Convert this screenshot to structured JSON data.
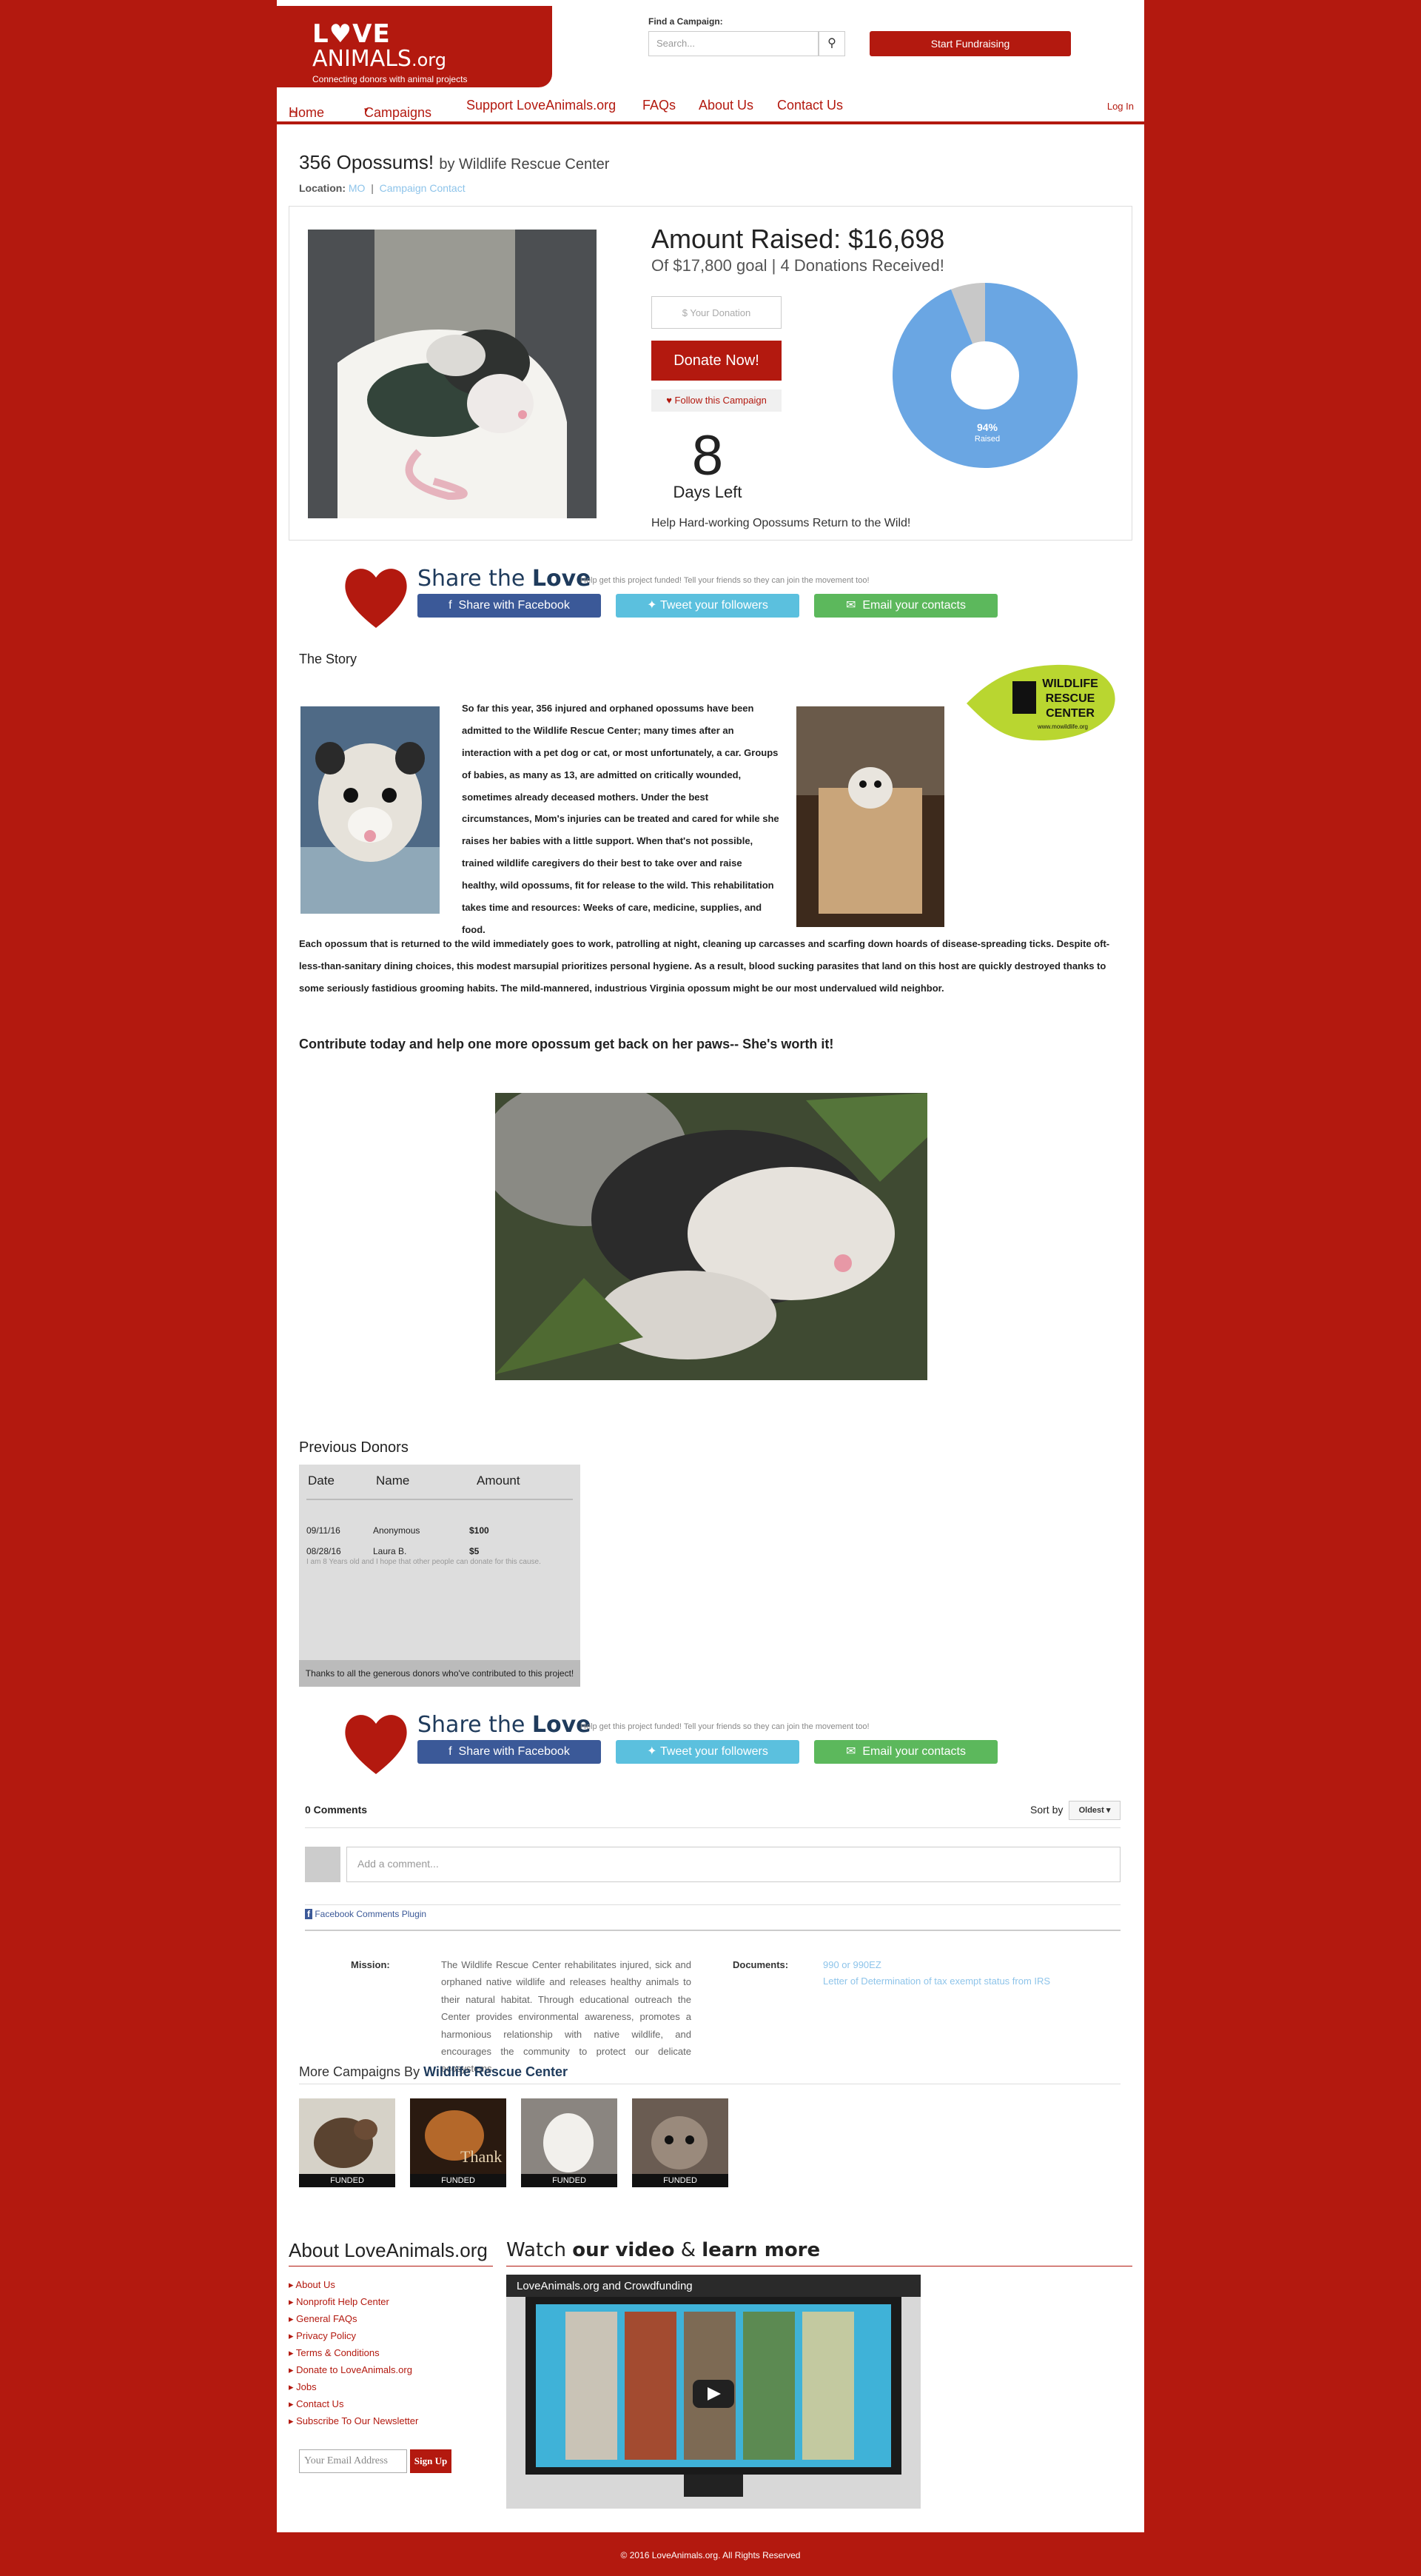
{
  "header": {
    "logo_line1": "L♥VE",
    "logo_line2": "ANIMALS",
    "logo_suffix": ".org",
    "tagline": "Connecting donors with animal projects",
    "find_label": "Find a Campaign:",
    "search_placeholder": "Search...",
    "start_label": "Start Fundraising"
  },
  "nav": {
    "home": "Home",
    "campaigns": "Campaigns",
    "support": "Support LoveAnimals.org",
    "faqs": "FAQs",
    "about": "About Us",
    "contact": "Contact Us",
    "login": "Log In"
  },
  "campaign": {
    "title": "356 Opossums!",
    "by": "by Wildlife Rescue Center",
    "location_label": "Location:",
    "location": "MO",
    "contact_link": "Campaign Contact",
    "amount_raised": "Amount Raised: $16,698",
    "goal_line": "Of $17,800 goal | 4 Donations Received!",
    "donation_placeholder": "$ Your Donation",
    "donate_label": "Donate Now!",
    "follow_label": "Follow this Campaign",
    "days": "8",
    "days_label": "Days Left",
    "subtitle": "Help Hard-working Opossums Return to the Wild!",
    "raised_fraction": 0.94,
    "pie_label_pct": "94%",
    "pie_label_text": "Raised"
  },
  "share": {
    "title_a": "Share the ",
    "title_b": "Love",
    "sub": "Help get this project funded! Tell your friends so they can join the movement too!",
    "facebook": "Share with Facebook",
    "twitter": "Tweet your followers",
    "email": "Email your contacts"
  },
  "story": {
    "heading": "The Story",
    "p1": "So far this year, 356 injured and orphaned opossums have been admitted to the Wildlife Rescue Center; many times after an interaction with a pet dog or cat, or most unfortunately, a car. Groups of babies, as many as 13, are admitted on critically wounded, sometimes already deceased mothers. Under the best circumstances, Mom's injuries can be treated and cared for while she raises her babies with a little support. When that's not possible, trained wildlife caregivers do their best to take over and raise healthy, wild opossums, fit for release to the wild. This rehabilitation takes time and resources: Weeks of care, medicine, supplies, and food.",
    "p2": "Each opossum that is returned to the wild immediately goes to work, patrolling at night, cleaning up carcasses and scarfing down hoards of disease-spreading ticks.  Despite oft-less-than-sanitary dining choices, this modest marsupial prioritizes personal hygiene. As a result, blood sucking parasites that land on this host are quickly destroyed thanks to some seriously fastidious grooming habits. The mild-mannered, industrious Virginia opossum might be our most undervalued wild neighbor.",
    "cta": "Contribute today and help one more opossum get back on her paws-- She's worth it!",
    "badge_line1": "WILDLIFE",
    "badge_line2": "RESCUE",
    "badge_line3": "CENTER",
    "badge_url": "www.mowildlife.org"
  },
  "donors": {
    "heading": "Previous Donors",
    "col_date": "Date",
    "col_name": "Name",
    "col_amount": "Amount",
    "rows": [
      {
        "date": "09/11/16",
        "name": "Anonymous",
        "amount": "$100",
        "note": ""
      },
      {
        "date": "08/28/16",
        "name": "Laura B.",
        "amount": "$5",
        "note": "I am 8 Years old and I hope that other people can donate for this cause."
      }
    ],
    "footer": "Thanks to all the generous donors who've contributed to this project!"
  },
  "comments": {
    "count": "0 Comments",
    "sort_label": "Sort by",
    "sort_value": "Oldest ▾",
    "placeholder": "Add a comment...",
    "plugin": "Facebook Comments Plugin"
  },
  "org": {
    "mission_label": "Mission:",
    "mission": "The Wildlife Rescue Center rehabilitates injured, sick and orphaned native wildlife and releases healthy animals to their natural habitat. Through educational outreach the Center provides environmental awareness, promotes a harmonious relationship with native wildlife, and encourages the community to protect our delicate ecosystems.",
    "documents_label": "Documents:",
    "doc1": "990 or 990EZ",
    "doc2": "Letter of Determination of tax exempt status from IRS"
  },
  "more": {
    "heading_a": "More Campaigns By ",
    "heading_b": "Wildlife Rescue Center",
    "funded": "FUNDED",
    "thumb2_text": "Thank"
  },
  "footer": {
    "about_title": "About LoveAnimals.org",
    "links": [
      "About Us",
      "Nonprofit Help Center",
      "General FAQs",
      "Privacy Policy",
      "Terms & Conditions",
      "Donate to LoveAnimals.org",
      "Jobs",
      "Contact Us",
      "Subscribe To Our Newsletter"
    ],
    "watch_a": "Watch ",
    "watch_b": "our video",
    "watch_c": " & ",
    "watch_d": "learn more",
    "video_title": "LoveAnimals.org and Crowdfunding",
    "email_placeholder": "Your Email Address",
    "signup": "Sign Up",
    "copyright": "© 2016 LoveAnimals.org. All Rights Reserved"
  },
  "colors": {
    "brand_red": "#b3190f",
    "facebook": "#3b5998",
    "twitter": "#5bc0de",
    "email": "#5cb85c",
    "pie_blue": "#6aa6e3",
    "pie_gray": "#c8c8c8"
  }
}
